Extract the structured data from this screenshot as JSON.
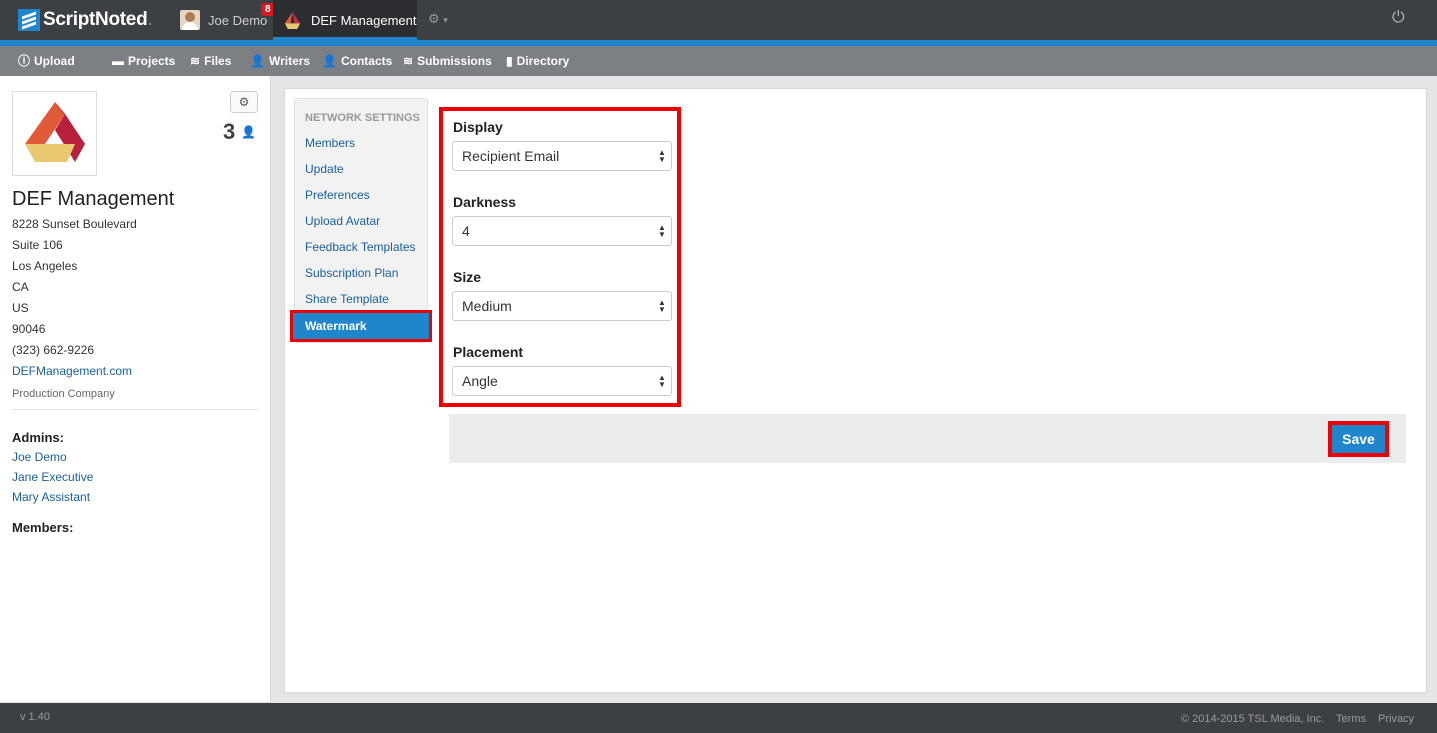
{
  "app": {
    "logo_text": "ScriptNoted",
    "logo_dot": "."
  },
  "topbar": {
    "user_name": "Joe Demo",
    "notification_count": "8",
    "org_tab": "DEF Management",
    "gear_icon": "gear-icon",
    "power_icon": "power-icon"
  },
  "subnav": {
    "items": [
      {
        "label": "Upload",
        "icon": "upload-icon"
      },
      {
        "label": "Projects",
        "icon": "folder-icon"
      },
      {
        "label": "Files",
        "icon": "layers-icon"
      },
      {
        "label": "Writers",
        "icon": "person-icon"
      },
      {
        "label": "Contacts",
        "icon": "person-icon"
      },
      {
        "label": "Submissions",
        "icon": "layers-icon"
      },
      {
        "label": "Directory",
        "icon": "book-icon"
      }
    ]
  },
  "org": {
    "name": "DEF Management",
    "member_count": "3",
    "address_lines": [
      "8228 Sunset Boulevard",
      "Suite 106",
      "Los Angeles",
      "CA",
      "US",
      "90046",
      "(323) 662-9226"
    ],
    "website": "DEFManagement.com",
    "type": "Production Company",
    "admins_label": "Admins:",
    "admins": [
      "Joe Demo",
      "Jane Executive",
      "Mary Assistant"
    ],
    "members_label": "Members:"
  },
  "settings_nav": {
    "heading": "NETWORK SETTINGS",
    "items": [
      "Members",
      "Update",
      "Preferences",
      "Upload Avatar",
      "Feedback Templates",
      "Subscription Plan",
      "Share Template"
    ],
    "active": "Watermark"
  },
  "watermark_form": {
    "display": {
      "label": "Display",
      "value": "Recipient Email"
    },
    "darkness": {
      "label": "Darkness",
      "value": "4"
    },
    "size": {
      "label": "Size",
      "value": "Medium"
    },
    "placement": {
      "label": "Placement",
      "value": "Angle"
    },
    "save_label": "Save"
  },
  "footer": {
    "version": "v 1.40",
    "copyright": "© 2014-2015 TSL Media, Inc.",
    "terms": "Terms",
    "privacy": "Privacy"
  },
  "colors": {
    "accent": "#1f86cc",
    "highlight": "#ee0000",
    "topbar": "#3c3f44"
  }
}
